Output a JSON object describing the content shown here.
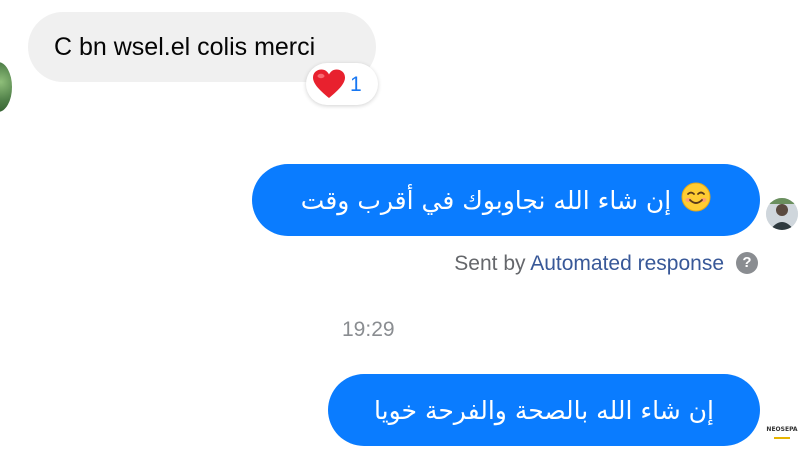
{
  "messages": {
    "incoming": {
      "text": "C bn wsel.el colis merci",
      "reaction": {
        "icon": "heart-emoji",
        "count": "1"
      }
    },
    "outgoing_1": {
      "text": "إن شاء الله نجاوبوك في أقرب وقت",
      "emoji": "😊"
    },
    "sent_by": {
      "prefix": "Sent by",
      "link": "Automated response",
      "help_icon": "question-icon"
    },
    "timestamp": "19:29",
    "outgoing_2": {
      "text": "إن شاء الله بالصحة والفرحة خويا"
    }
  },
  "colors": {
    "outgoing_bubble": "#0a7cff",
    "incoming_bubble": "#f0f0f0",
    "link": "#385898",
    "reaction_count": "#1877f2"
  },
  "avatars": {
    "page_logo_text": "NEOSEPA"
  }
}
